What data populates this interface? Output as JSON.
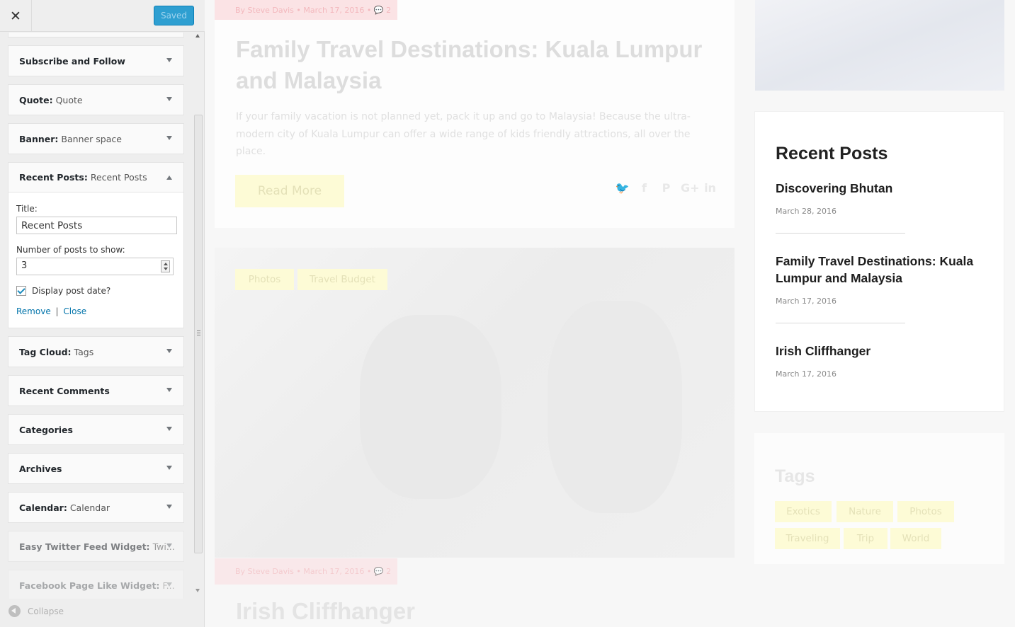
{
  "customizer": {
    "close_icon": "✕",
    "saved_label": "Saved",
    "collapse_label": "Collapse",
    "widgets": [
      {
        "title": "Subscribe and Follow",
        "sub": ""
      },
      {
        "title": "Quote:",
        "sub": "Quote"
      },
      {
        "title": "Banner:",
        "sub": "Banner space"
      }
    ],
    "open_widget": {
      "title": "Recent Posts:",
      "sub": "Recent Posts",
      "title_label": "Title:",
      "title_value": "Recent Posts",
      "number_label": "Number of posts to show:",
      "number_value": "3",
      "checkbox_label": "Display post date?",
      "checkbox_checked": true,
      "remove_label": "Remove",
      "separator": "|",
      "close_label": "Close"
    },
    "widgets_after": [
      {
        "title": "Tag Cloud:",
        "sub": "Tags"
      },
      {
        "title": "Recent Comments",
        "sub": ""
      },
      {
        "title": "Categories",
        "sub": ""
      },
      {
        "title": "Archives",
        "sub": ""
      },
      {
        "title": "Calendar:",
        "sub": "Calendar"
      },
      {
        "title": "Easy Twitter Feed Widget:",
        "sub": "Twi..."
      },
      {
        "title": "Facebook Page Like Widget:",
        "sub": "F..."
      }
    ]
  },
  "preview": {
    "post1": {
      "meta": "By Steve Davis • March 17, 2016 • 💬 2",
      "title": "Family Travel Destinations: Kuala Lumpur and Malaysia",
      "excerpt": "If your family vacation is not planned yet, pack it up and go to Malaysia! Because the ultra-modern city of Kuala Lumpur can offer a wide range of kids friendly attractions, all over the place.",
      "read_more": "Read More"
    },
    "social_icons": [
      "twitter-icon",
      "facebook-icon",
      "pinterest-icon",
      "google-plus-icon",
      "linkedin-icon"
    ],
    "social_glyphs": [
      "🐦",
      "f",
      "P",
      "G+",
      "in"
    ],
    "post2": {
      "tags": [
        "Photos",
        "Travel Budget"
      ],
      "meta": "By Steve Davis • March 17, 2016 • 💬 2",
      "title": "Irish Cliffhanger"
    },
    "recent_posts_widget": {
      "heading": "Recent Posts",
      "items": [
        {
          "title": "Discovering Bhutan",
          "date": "March 28, 2016"
        },
        {
          "title": "Family Travel Destinations: Kuala Lumpur and Malaysia",
          "date": "March 17, 2016"
        },
        {
          "title": "Irish Cliffhanger",
          "date": "March 17, 2016"
        }
      ]
    },
    "tags_widget": {
      "heading": "Tags",
      "tags": [
        "Exotics",
        "Nature",
        "Photos",
        "Traveling",
        "Trip",
        "World"
      ]
    }
  },
  "colors": {
    "saved_button": "#2e9fd1",
    "link": "#0073aa",
    "meta_bar": "#fbe3e5",
    "tag_pill": "#fdfbd6"
  }
}
